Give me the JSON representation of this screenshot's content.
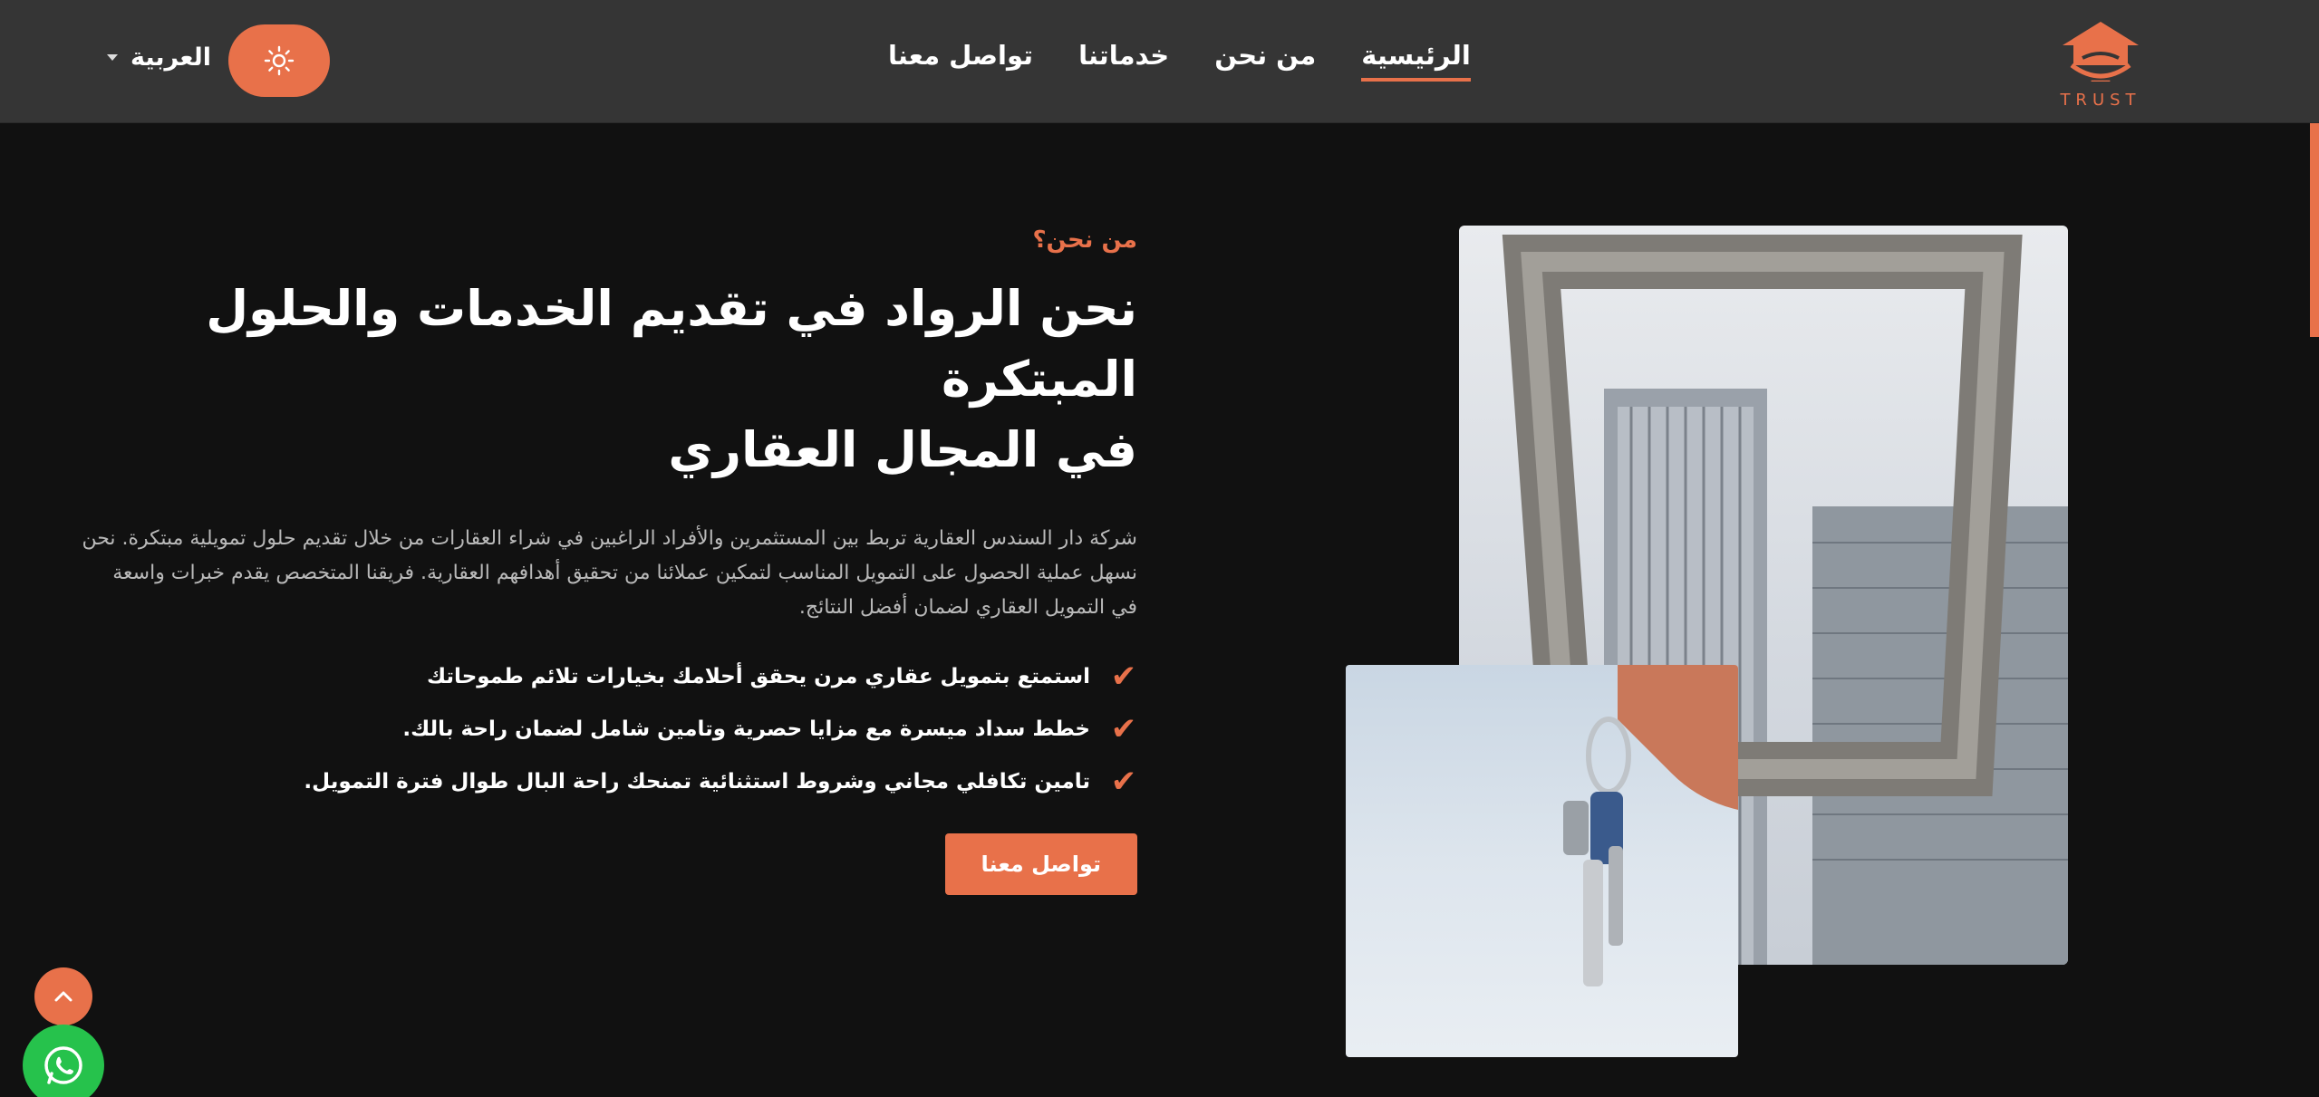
{
  "brand": {
    "logo_text": "TRUST",
    "accent": "#e8714a"
  },
  "nav": {
    "items": [
      {
        "label": "الرئيسية",
        "active": true
      },
      {
        "label": "من نحن",
        "active": false
      },
      {
        "label": "خدماتنا",
        "active": false
      },
      {
        "label": "تواصل معنا",
        "active": false
      }
    ]
  },
  "language": {
    "selected": "العربية"
  },
  "about": {
    "eyebrow": "من نحن؟",
    "title_line1": "نحن الرواد في تقديم الخدمات والحلول المبتكرة",
    "title_line2": "في المجال العقاري",
    "description": "شركة دار السندس العقارية تربط بين المستثمرين والأفراد الراغبين في شراء العقارات من خلال تقديم حلول تمويلية مبتكرة. نحن نسهل عملية الحصول على التمويل المناسب لتمكين عملائنا من تحقيق أهدافهم العقارية. فريقنا المتخصص يقدم خبرات واسعة في التمويل العقاري لضمان أفضل النتائج.",
    "features": [
      "استمتع بتمويل عقاري مرن يحقق أحلامك بخيارات تلائم طموحاتك",
      "خطط سداد ميسرة مع مزايا حصرية وتامين شامل لضمان راحة بالك.",
      "تامين تكافلي مجاني وشروط استثنائية تمنحك راحة البال طوال فترة التمويل."
    ],
    "cta_label": "تواصل معنا"
  }
}
